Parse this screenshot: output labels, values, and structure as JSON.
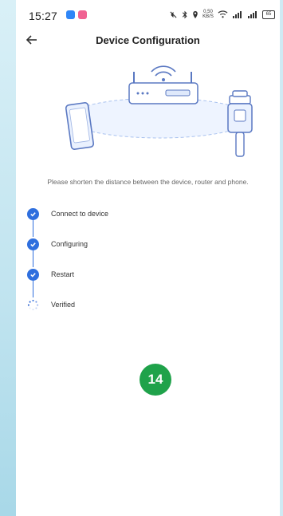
{
  "status_bar": {
    "time": "15:27",
    "right_text": "0.50 KB/S",
    "battery": "65",
    "icons": [
      "mute-icon",
      "bluetooth-icon",
      "location-icon",
      "wifi-icon",
      "signal-icon",
      "signal-icon",
      "battery-icon"
    ]
  },
  "header": {
    "title": "Device Configuration",
    "back_icon": "arrow-left-icon"
  },
  "illustration": {
    "items": [
      "phone",
      "router",
      "device"
    ]
  },
  "hint": "Please shorten the distance between the device, router and phone.",
  "steps": [
    {
      "label": "Connect to device",
      "status": "done"
    },
    {
      "label": "Configuring",
      "status": "done"
    },
    {
      "label": "Restart",
      "status": "done"
    },
    {
      "label": "Verified",
      "status": "loading"
    }
  ],
  "counter": "14",
  "colors": {
    "accent": "#2f6fde",
    "counter": "#1fa24a",
    "frame": "#bfe3ef"
  }
}
